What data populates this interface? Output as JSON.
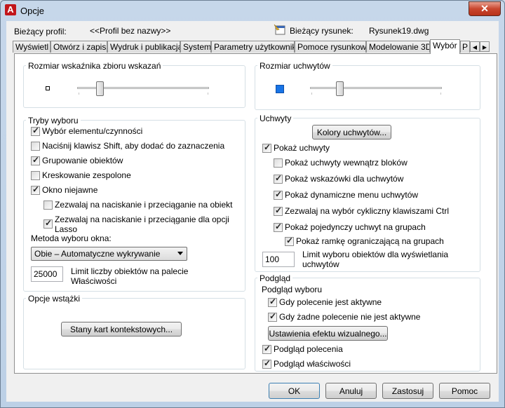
{
  "window": {
    "title": "Opcje",
    "close_glyph": "✕",
    "app_icon_letter": "A"
  },
  "profile": {
    "label": "Bieżący profil:",
    "value": "<<Profil bez nazwy>>",
    "drawing_label": "Bieżący rysunek:",
    "drawing_value": "Rysunek19.dwg"
  },
  "tabs": [
    {
      "label": "Wyświetl"
    },
    {
      "label": "Otwórz i zapisz"
    },
    {
      "label": "Wydruk i publikacja"
    },
    {
      "label": "System"
    },
    {
      "label": "Parametry użytkownika"
    },
    {
      "label": "Pomoce rysunkowe"
    },
    {
      "label": "Modelowanie 3D"
    },
    {
      "label": "Wybór",
      "active": true
    },
    {
      "label": "P"
    }
  ],
  "tab_scroll": {
    "left": "◀",
    "right": "▶"
  },
  "left": {
    "pickbox": {
      "title": "Rozmiar wskaźnika zbioru wskazań",
      "level": 0.3
    },
    "modes": {
      "title": "Tryby wyboru",
      "items": [
        {
          "label": "Wybór elementu/czynności",
          "checked": true
        },
        {
          "label": "Naciśnij klawisz Shift, aby dodać do zaznaczenia",
          "checked": false
        },
        {
          "label": "Grupowanie obiektów",
          "checked": true
        },
        {
          "label": "Kreskowanie zespolone",
          "checked": false
        },
        {
          "label": "Okno niejawne",
          "checked": true
        },
        {
          "label": "Zezwalaj na naciskanie i przeciąganie na obiekt",
          "checked": false
        },
        {
          "label": "Zezwalaj na naciskanie i przeciąganie dla opcji",
          "label2": "Lasso",
          "checked": true
        }
      ],
      "method_label": "Metoda wyboru okna:",
      "method_value": "Obie – Automatyczne wykrywanie",
      "limit_value": "25000",
      "limit_label1": "Limit liczby obiektów na palecie",
      "limit_label2": "Właściwości"
    },
    "ribbon": {
      "title": "Opcje wstążki",
      "button": "Stany kart kontekstowych..."
    }
  },
  "right": {
    "grip_size": {
      "title": "Rozmiar uchwytów",
      "level": 0.22
    },
    "grips": {
      "title": "Uchwyty",
      "colors_button": "Kolory uchwytów...",
      "items": [
        {
          "label": "Pokaż uchwyty",
          "checked": true
        },
        {
          "label": "Pokaż uchwyty wewnątrz bloków",
          "checked": false
        },
        {
          "label": "Pokaż wskazówki dla uchwytów",
          "checked": true
        },
        {
          "label": "Pokaż dynamiczne menu uchwytów",
          "checked": true
        },
        {
          "label": "Zezwalaj na wybór cykliczny klawiszami Ctrl",
          "checked": true
        },
        {
          "label": "Pokaż pojedynczy uchwyt na grupach",
          "checked": true
        },
        {
          "label": "Pokaż ramkę ograniczającą na grupach",
          "checked": true
        }
      ],
      "limit_value": "100",
      "limit_label1": "Limit wyboru obiektów dla wyświetlania",
      "limit_label2": "uchwytów"
    },
    "preview": {
      "title": "Podgląd",
      "sub_title": "Podgląd wyboru",
      "items": [
        {
          "label": "Gdy polecenie jest aktywne",
          "checked": true
        },
        {
          "label": "Gdy żadne polecenie nie jest aktywne",
          "checked": true
        }
      ],
      "effects_button": "Ustawienia efektu wizualnego...",
      "items2": [
        {
          "label": "Podgląd polecenia",
          "checked": true
        },
        {
          "label": "Podgląd właściwości",
          "checked": true
        }
      ]
    }
  },
  "footer": {
    "ok": "OK",
    "cancel": "Anuluj",
    "apply": "Zastosuj",
    "help": "Pomoc"
  },
  "colors": {
    "grip_blue": "#1874e6",
    "close_red": "#c9472f"
  }
}
